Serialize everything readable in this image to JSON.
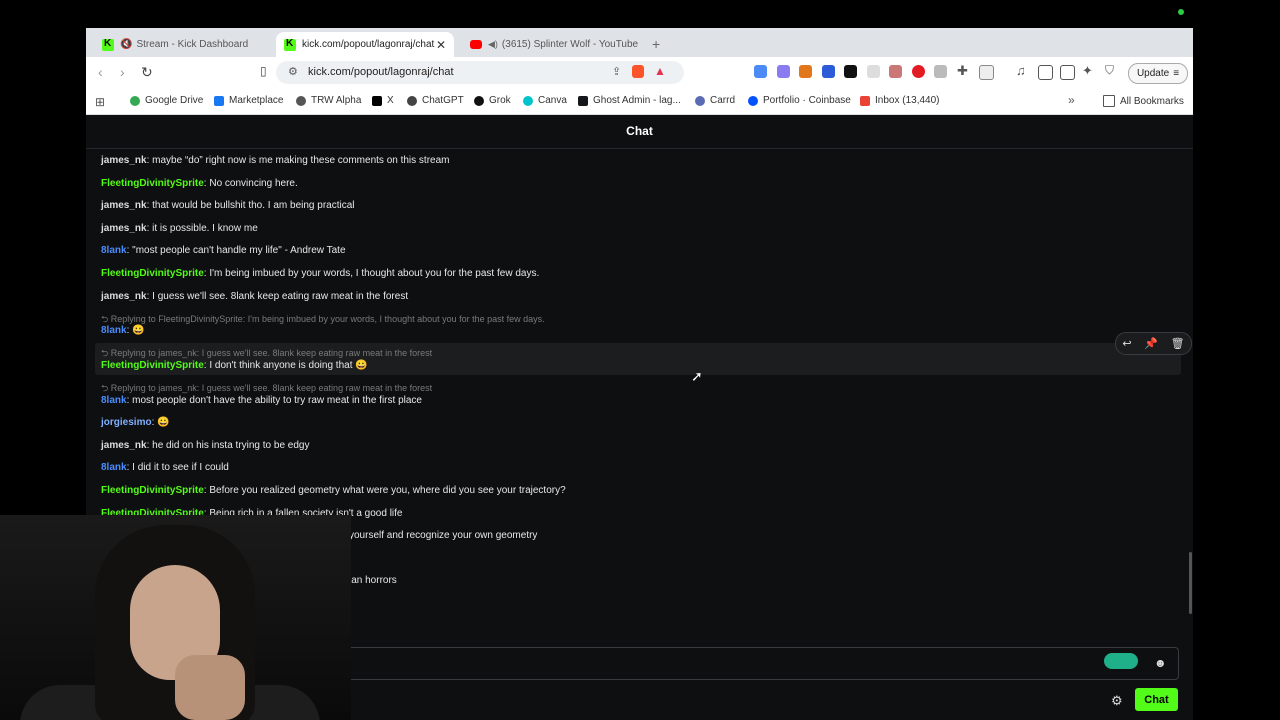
{
  "tabs": [
    {
      "label": "Stream - Kick Dashboard",
      "active": false
    },
    {
      "label": "kick.com/popout/lagonraj/chat",
      "active": true
    },
    {
      "label": "(3615) Splinter Wolf - YouTube",
      "active": false
    }
  ],
  "toolbar": {
    "url": "kick.com/popout/lagonraj/chat",
    "update_label": "Update"
  },
  "bookmarks": [
    "Google Drive",
    "Marketplace",
    "TRW Alpha",
    "X",
    "ChatGPT",
    "Grok",
    "Canva",
    "Ghost Admin - lag...",
    "Carrd",
    "Portfolio · Coinbase",
    "Inbox (13,440)"
  ],
  "all_bookmarks": "All Bookmarks",
  "chat": {
    "title": "Chat",
    "messages": [
      {
        "user": "james_nk",
        "text": "maybe “do” right now is me making these comments on this stream"
      },
      {
        "user": "FleetingDivinitySprite",
        "text": "No convincing here."
      },
      {
        "user": "james_nk",
        "text": "that would be bullshit tho. I am being practical"
      },
      {
        "user": "james_nk",
        "text": "it is possible. I know me"
      },
      {
        "user": "8lank",
        "text": "\"most people can't handle my life\" - Andrew Tate"
      },
      {
        "user": "FleetingDivinitySprite",
        "text": "I'm being imbued by your words, I thought about you for the past few days."
      },
      {
        "user": "james_nk",
        "text": "I guess we'll see. 8lank keep eating raw meat in the forest"
      },
      {
        "reply": "Replying to FleetingDivinitySprite: I'm being imbued by your words, I thought about you for the past few days.",
        "user": "8lank",
        "text": "😀"
      },
      {
        "reply": "Replying to james_nk: I guess we'll see. 8lank keep eating raw meat in the forest",
        "user": "FleetingDivinitySprite",
        "text": "I don't think anyone is doing that 😀"
      },
      {
        "reply": "Replying to james_nk: I guess we'll see. 8lank keep eating raw meat in the forest",
        "user": "8lank",
        "text": "most people don't have the ability to try raw meat in the first place"
      },
      {
        "user": "jorgiesimo",
        "text": "😀"
      },
      {
        "user": "james_nk",
        "text": "he did on his insta trying to be edgy"
      },
      {
        "user": "8lank",
        "text": "I did it to see if I could"
      },
      {
        "user": "FleetingDivinitySprite",
        "text": "Before you realized geometry what were you, where did you see your trajectory?"
      },
      {
        "user": "FleetingDivinitySprite",
        "text": "Being rich in a fallen society isn't a good life"
      }
    ],
    "partial": [
      "yourself and recognize your own geometry",
      "ian horrors"
    ],
    "send_label": "Chat"
  },
  "colors": {
    "kick_green": "#53fc18",
    "user_white": "#dcdcdc",
    "user_blue": "#4a8cff"
  }
}
